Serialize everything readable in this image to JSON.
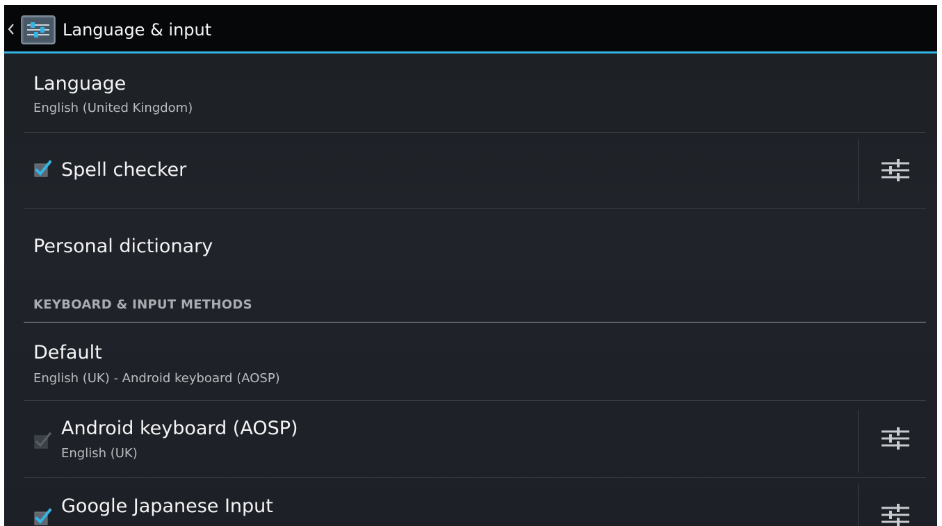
{
  "actionbar": {
    "title": "Language & input",
    "up_icon": "chevron-left-icon",
    "app_icon": "settings-app-icon"
  },
  "items": {
    "language": {
      "title": "Language",
      "summary": "English (United Kingdom)"
    },
    "spell_checker": {
      "title": "Spell checker",
      "checked": true,
      "settings_icon": "sliders-icon"
    },
    "personal_dictionary": {
      "title": "Personal dictionary"
    },
    "section_keyboard": "KEYBOARD & INPUT METHODS",
    "default": {
      "title": "Default",
      "summary": "English (UK) - Android keyboard (AOSP)"
    },
    "android_keyboard": {
      "title": "Android keyboard (AOSP)",
      "summary": "English (UK)",
      "checked": true,
      "disabled": true,
      "settings_icon": "sliders-icon"
    },
    "google_japanese": {
      "title": "Google Japanese Input",
      "checked": true,
      "settings_icon": "sliders-icon"
    }
  },
  "colors": {
    "accent": "#33b5e5",
    "background": "#1d2127",
    "actionbar": "#060708"
  }
}
